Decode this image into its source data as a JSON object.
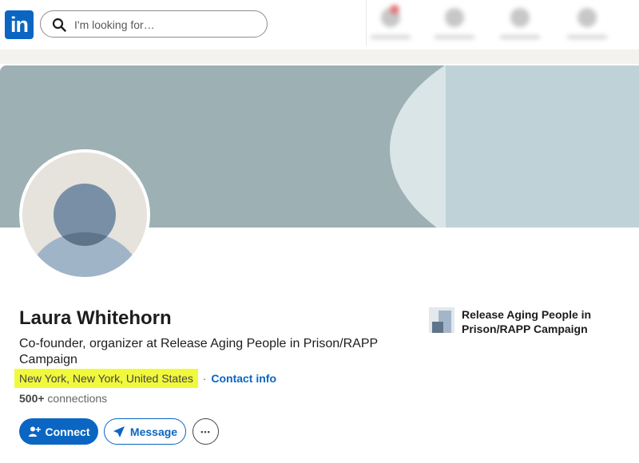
{
  "nav": {
    "logo_text": "in",
    "search_placeholder": "I'm looking for…"
  },
  "profile": {
    "name": "Laura Whitehorn",
    "headline": "Co-founder, organizer at Release Aging People in Prison/RAPP Campaign",
    "location": "New York, New York, United States",
    "separator": "·",
    "contact_info_label": "Contact info",
    "connections_count": "500+",
    "connections_label": " connections"
  },
  "actions": {
    "connect_label": "Connect",
    "message_label": "Message",
    "more_label": "•••"
  },
  "organization": {
    "name": "Release Aging People in Prison/RAPP Campaign"
  },
  "colors": {
    "brand": "#0a66c2",
    "highlight": "#f1f93c",
    "banner": "#9db0b3"
  }
}
